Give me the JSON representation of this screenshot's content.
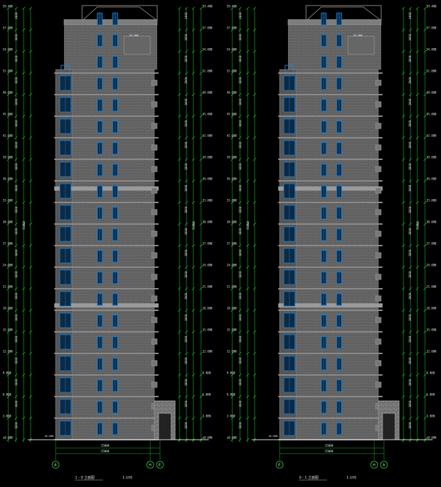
{
  "drawings": [
    {
      "id": "left",
      "caption": "1 - 9 立面图",
      "scale": "1:100",
      "axes": [
        "A",
        "H",
        "E"
      ],
      "span_label_top": "15000",
      "span_label_bottom": "15000",
      "roof_label": "54.000",
      "base_label": "±0.000"
    },
    {
      "id": "right",
      "caption": "9 - 1 立面图",
      "scale": "1:100",
      "axes": [
        "E",
        "H",
        "A"
      ],
      "span_label_top": "15000",
      "span_label_bottom": "15000",
      "roof_label": "54.000",
      "base_label": "±0.000"
    }
  ],
  "floor_elevations": [
    "59.400",
    "57.000",
    "54.000",
    "51.000",
    "48.000",
    "45.000",
    "42.000",
    "39.000",
    "36.000",
    "33.000",
    "30.000",
    "27.000",
    "24.000",
    "21.000",
    "18.000",
    "15.000",
    "12.000",
    "9.000",
    "6.000",
    "3.000",
    "±0.000"
  ],
  "floor_heights": [
    "2400",
    "3000",
    "3000",
    "3000",
    "3000",
    "3000",
    "3000",
    "3000",
    "3000",
    "3000",
    "3000",
    "3000",
    "3000",
    "3000",
    "3000",
    "3000",
    "3000",
    "3000",
    "3000",
    "3000"
  ],
  "total_height": "59400",
  "colors": {
    "background": "#000000",
    "dimension_line": "#22c02a",
    "facade_brick": "#6b6b6b",
    "brick_joint": "#4a4a4a",
    "slab": "#8a8a8a",
    "window_frame": "#1f7fd0",
    "window_glass": "#0b2a45",
    "text": "#e8e8e8",
    "axis_circle": "#2ecc40"
  }
}
